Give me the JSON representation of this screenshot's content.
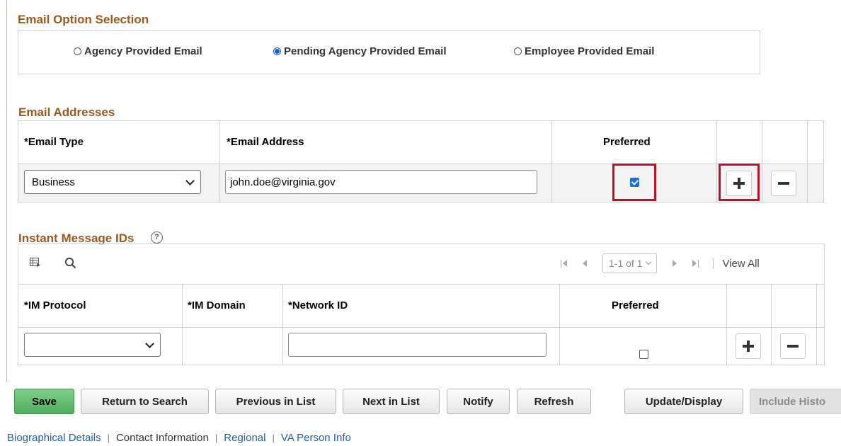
{
  "email_option": {
    "title": "Email Option Selection",
    "options": [
      {
        "label": "Agency Provided Email",
        "selected": false
      },
      {
        "label": "Pending Agency Provided Email",
        "selected": true
      },
      {
        "label": "Employee Provided Email",
        "selected": false
      }
    ]
  },
  "email_addresses": {
    "title": "Email Addresses",
    "headers": {
      "email_type": "*Email Type",
      "email_address": "*Email Address",
      "preferred": "Preferred"
    },
    "rows": [
      {
        "email_type": "Business",
        "email_address": "john.doe@virginia.gov",
        "preferred": true
      }
    ]
  },
  "instant_message": {
    "title": "Instant Message IDs",
    "help_icon": "question-circle-icon",
    "toolbar": {
      "pager": "1-1 of 1",
      "view_all": "View All"
    },
    "headers": {
      "im_protocol": "*IM Protocol",
      "im_domain": "*IM Domain",
      "network_id": "*Network ID",
      "preferred": "Preferred"
    },
    "rows": [
      {
        "im_protocol": "",
        "im_domain": "",
        "network_id": "",
        "preferred": false
      }
    ]
  },
  "buttons": {
    "save": "Save",
    "return_to_search": "Return to Search",
    "previous_in_list": "Previous in List",
    "next_in_list": "Next in List",
    "notify": "Notify",
    "refresh": "Refresh",
    "update_display": "Update/Display",
    "include_history": "Include Histo"
  },
  "links": {
    "biographical_details": "Biographical Details",
    "contact_information": "Contact Information",
    "regional": "Regional",
    "va_person_info": "VA Person Info",
    "separator": "|"
  },
  "colors": {
    "section_title": "#9c5a21",
    "highlight": "#c0102a",
    "save_green": "#4fae5d",
    "link": "#2162a6"
  }
}
